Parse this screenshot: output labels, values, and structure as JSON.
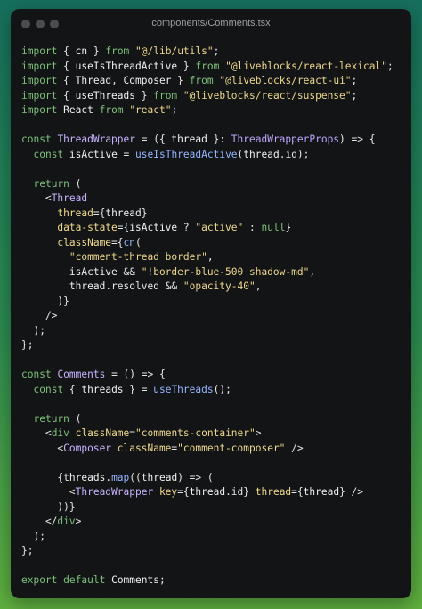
{
  "window": {
    "title": "components/Comments.tsx"
  },
  "colors": {
    "keyword": "#7ec27a",
    "string": "#efd78b",
    "component": "#c9b3ff",
    "function": "#94b5ff",
    "identifier": "#f1f1f1",
    "type": "#bfa6ff",
    "attribute": "#f3db8c",
    "punctuation": "#e6e6e6"
  },
  "code_lines": [
    [
      [
        "k",
        "import"
      ],
      [
        "p",
        " { "
      ],
      [
        "i",
        "cn"
      ],
      [
        "p",
        " } "
      ],
      [
        "k",
        "from"
      ],
      [
        "p",
        " "
      ],
      [
        "s",
        "\"@/lib/utils\""
      ],
      [
        "p",
        ";"
      ]
    ],
    [
      [
        "k",
        "import"
      ],
      [
        "p",
        " { "
      ],
      [
        "i",
        "useIsThreadActive"
      ],
      [
        "p",
        " } "
      ],
      [
        "k",
        "from"
      ],
      [
        "p",
        " "
      ],
      [
        "s",
        "\"@liveblocks/react-lexical\""
      ],
      [
        "p",
        ";"
      ]
    ],
    [
      [
        "k",
        "import"
      ],
      [
        "p",
        " { "
      ],
      [
        "i",
        "Thread"
      ],
      [
        "p",
        ", "
      ],
      [
        "i",
        "Composer"
      ],
      [
        "p",
        " } "
      ],
      [
        "k",
        "from"
      ],
      [
        "p",
        " "
      ],
      [
        "s",
        "\"@liveblocks/react-ui\""
      ],
      [
        "p",
        ";"
      ]
    ],
    [
      [
        "k",
        "import"
      ],
      [
        "p",
        " { "
      ],
      [
        "i",
        "useThreads"
      ],
      [
        "p",
        " } "
      ],
      [
        "k",
        "from"
      ],
      [
        "p",
        " "
      ],
      [
        "s",
        "\"@liveblocks/react/suspense\""
      ],
      [
        "p",
        ";"
      ]
    ],
    [
      [
        "k",
        "import"
      ],
      [
        "p",
        " "
      ],
      [
        "i",
        "React"
      ],
      [
        "p",
        " "
      ],
      [
        "k",
        "from"
      ],
      [
        "p",
        " "
      ],
      [
        "s",
        "\"react\""
      ],
      [
        "p",
        ";"
      ]
    ],
    [],
    [
      [
        "k",
        "const"
      ],
      [
        "p",
        " "
      ],
      [
        "c",
        "ThreadWrapper"
      ],
      [
        "p",
        " = ({ "
      ],
      [
        "i",
        "thread"
      ],
      [
        "p",
        " }: "
      ],
      [
        "t",
        "ThreadWrapperProps"
      ],
      [
        "p",
        ") => {"
      ]
    ],
    [
      [
        "p",
        "  "
      ],
      [
        "k",
        "const"
      ],
      [
        "p",
        " "
      ],
      [
        "i",
        "isActive"
      ],
      [
        "p",
        " = "
      ],
      [
        "f",
        "useIsThreadActive"
      ],
      [
        "p",
        "("
      ],
      [
        "i",
        "thread"
      ],
      [
        "p",
        ".id);"
      ]
    ],
    [],
    [
      [
        "p",
        "  "
      ],
      [
        "k",
        "return"
      ],
      [
        "p",
        " ("
      ]
    ],
    [
      [
        "p",
        "    <"
      ],
      [
        "c",
        "Thread"
      ]
    ],
    [
      [
        "p",
        "      "
      ],
      [
        "a",
        "thread"
      ],
      [
        "p",
        "={"
      ],
      [
        "i",
        "thread"
      ],
      [
        "p",
        "}"
      ]
    ],
    [
      [
        "p",
        "      "
      ],
      [
        "a",
        "data-state"
      ],
      [
        "p",
        "={"
      ],
      [
        "i",
        "isActive"
      ],
      [
        "p",
        " ? "
      ],
      [
        "s",
        "\"active\""
      ],
      [
        "p",
        " : "
      ],
      [
        "k",
        "null"
      ],
      [
        "p",
        "}"
      ]
    ],
    [
      [
        "p",
        "      "
      ],
      [
        "a",
        "className"
      ],
      [
        "p",
        "={"
      ],
      [
        "f",
        "cn"
      ],
      [
        "p",
        "("
      ]
    ],
    [
      [
        "p",
        "        "
      ],
      [
        "s",
        "\"comment-thread border\""
      ],
      [
        "p",
        ","
      ]
    ],
    [
      [
        "p",
        "        "
      ],
      [
        "i",
        "isActive"
      ],
      [
        "p",
        " && "
      ],
      [
        "s",
        "\"!border-blue-500 shadow-md\""
      ],
      [
        "p",
        ","
      ]
    ],
    [
      [
        "p",
        "        "
      ],
      [
        "i",
        "thread"
      ],
      [
        "p",
        ".resolved && "
      ],
      [
        "s",
        "\"opacity-40\""
      ],
      [
        "p",
        ","
      ]
    ],
    [
      [
        "p",
        "      )}"
      ]
    ],
    [
      [
        "p",
        "    />"
      ]
    ],
    [
      [
        "p",
        "  );"
      ]
    ],
    [
      [
        "p",
        "};"
      ]
    ],
    [],
    [
      [
        "k",
        "const"
      ],
      [
        "p",
        " "
      ],
      [
        "c",
        "Comments"
      ],
      [
        "p",
        " = () => {"
      ]
    ],
    [
      [
        "p",
        "  "
      ],
      [
        "k",
        "const"
      ],
      [
        "p",
        " { "
      ],
      [
        "i",
        "threads"
      ],
      [
        "p",
        " } = "
      ],
      [
        "f",
        "useThreads"
      ],
      [
        "p",
        "();"
      ]
    ],
    [],
    [
      [
        "p",
        "  "
      ],
      [
        "k",
        "return"
      ],
      [
        "p",
        " ("
      ]
    ],
    [
      [
        "p",
        "    <"
      ],
      [
        "k",
        "div"
      ],
      [
        "p",
        " "
      ],
      [
        "a",
        "className"
      ],
      [
        "p",
        "="
      ],
      [
        "s",
        "\"comments-container\""
      ],
      [
        "p",
        ">"
      ]
    ],
    [
      [
        "p",
        "      <"
      ],
      [
        "c",
        "Composer"
      ],
      [
        "p",
        " "
      ],
      [
        "a",
        "className"
      ],
      [
        "p",
        "="
      ],
      [
        "s",
        "\"comment-composer\""
      ],
      [
        "p",
        " />"
      ]
    ],
    [],
    [
      [
        "p",
        "      {"
      ],
      [
        "i",
        "threads"
      ],
      [
        "p",
        "."
      ],
      [
        "f",
        "map"
      ],
      [
        "p",
        "(("
      ],
      [
        "i",
        "thread"
      ],
      [
        "p",
        ") => ("
      ]
    ],
    [
      [
        "p",
        "        <"
      ],
      [
        "c",
        "ThreadWrapper"
      ],
      [
        "p",
        " "
      ],
      [
        "a",
        "key"
      ],
      [
        "p",
        "={"
      ],
      [
        "i",
        "thread"
      ],
      [
        "p",
        ".id} "
      ],
      [
        "a",
        "thread"
      ],
      [
        "p",
        "={"
      ],
      [
        "i",
        "thread"
      ],
      [
        "p",
        "} />"
      ]
    ],
    [
      [
        "p",
        "      ))}"
      ]
    ],
    [
      [
        "p",
        "    </"
      ],
      [
        "k",
        "div"
      ],
      [
        "p",
        ">"
      ]
    ],
    [
      [
        "p",
        "  );"
      ]
    ],
    [
      [
        "p",
        "};"
      ]
    ],
    [],
    [
      [
        "k",
        "export"
      ],
      [
        "p",
        " "
      ],
      [
        "k",
        "default"
      ],
      [
        "p",
        " "
      ],
      [
        "i",
        "Comments"
      ],
      [
        "p",
        ";"
      ]
    ]
  ]
}
